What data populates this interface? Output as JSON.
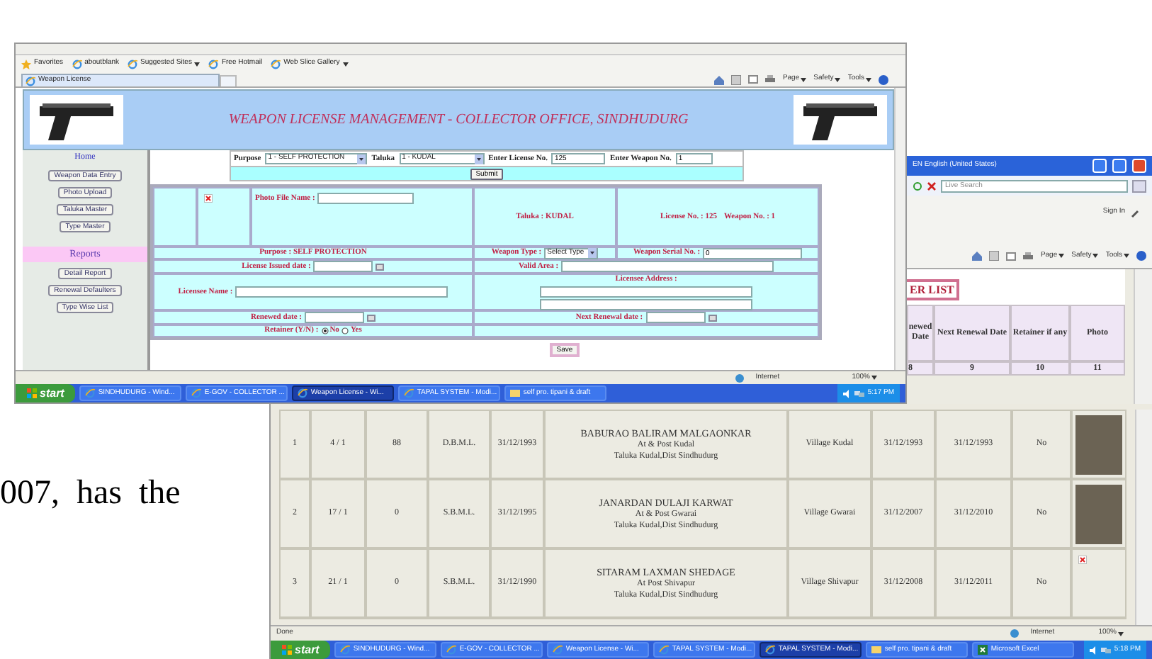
{
  "document_text": "007,  has  the",
  "front_window": {
    "favorites_bar": [
      {
        "label": "Favorites",
        "kind": "favorites"
      },
      {
        "label": "aboutblank",
        "kind": "link"
      },
      {
        "label": "Suggested Sites",
        "kind": "menu"
      },
      {
        "label": "Free Hotmail",
        "kind": "link"
      },
      {
        "label": "Web Slice Gallery",
        "kind": "menu"
      }
    ],
    "tab": "Weapon License",
    "command_bar": [
      "Page",
      "Safety",
      "Tools"
    ],
    "banner_title": "WEAPON LICENSE MANAGEMENT - COLLECTOR OFFICE, SINDHUDURG",
    "sidebar": {
      "home": "Home",
      "buttons": [
        "Weapon Data Entry",
        "Photo Upload",
        "Taluka Master",
        "Type Master"
      ],
      "reports_heading": "Reports",
      "report_buttons": [
        "Detail Report",
        "Renewal Defaulters",
        "Type Wise List"
      ]
    },
    "filter": {
      "purpose_label": "Purpose",
      "purpose_value": "1 - SELF PROTECTION",
      "taluka_label": "Taluka",
      "taluka_value": "1 - KUDAL",
      "license_label": "Enter License No.",
      "license_value": "125",
      "weapon_label": "Enter Weapon No.",
      "weapon_value": "1",
      "submit": "Submit"
    },
    "form": {
      "photo_file_label": "Photo File Name :",
      "taluka": "Taluka : KUDAL",
      "license": "License No. : 125",
      "weapon": "Weapon No. : 1",
      "purpose": "Purpose : SELF PROTECTION",
      "weapon_type_label": "Weapon Type :",
      "weapon_type_value": "Select Type",
      "serial_label": "Weapon Serial No. :",
      "serial_value": "0",
      "issued_label": "License Issued date :",
      "valid_area_label": "Valid Area :",
      "licensee_name_label": "Licensee Name :",
      "address_label": "Licensee Address :",
      "renewed_label": "Renewed date :",
      "next_renewal_label": "Next Renewal date :",
      "retainer_label": "Retainer (Y/N) :",
      "retainer_options": [
        {
          "label": "No",
          "selected": true
        },
        {
          "label": "Yes",
          "selected": false
        }
      ]
    },
    "save": "Save",
    "status_bar": {
      "zone": "Internet",
      "zoom": "100%"
    },
    "taskbar": {
      "start": "start",
      "items": [
        {
          "label": "SINDHUDURG - Wind...",
          "kind": "browser",
          "selected": false
        },
        {
          "label": "E-GOV - COLLECTOR ...",
          "kind": "browser",
          "selected": false
        },
        {
          "label": "Weapon License - Wi...",
          "kind": "browser",
          "selected": true
        },
        {
          "label": "TAPAL SYSTEM - Modi...",
          "kind": "browser",
          "selected": false
        },
        {
          "label": "self pro. tipani & draft",
          "kind": "folder",
          "selected": false
        }
      ],
      "clock": "5:17 PM"
    }
  },
  "back_window": {
    "language_bar": "EN English (United States)",
    "search_placeholder": "Live Search",
    "sign_in": "Sign In",
    "command_bar": [
      "Page",
      "Safety",
      "Tools"
    ],
    "heading": "ER LIST",
    "columns": [
      {
        "header": "newed Date",
        "number": "8"
      },
      {
        "header": "Next Renewal Date",
        "number": "9"
      },
      {
        "header": "Retainer if any",
        "number": "10"
      },
      {
        "header": "Photo",
        "number": "11"
      }
    ],
    "rows": [
      {
        "cells": [
          "1",
          "4 / 1",
          "88",
          "D.B.M.L.",
          "31/12/1993"
        ],
        "licensee": [
          "BABURAO BALIRAM MALGAONKAR",
          "At & Post Kudal",
          "Taluka Kudal,Dist Sindhudurg"
        ],
        "cells_after": [
          "Village Kudal",
          "31/12/1993",
          "31/12/1993",
          "No"
        ],
        "photo": {
          "kind": "photo"
        }
      },
      {
        "cells": [
          "2",
          "17 / 1",
          "0",
          "S.B.M.L.",
          "31/12/1995"
        ],
        "licensee": [
          "JANARDAN DULAJI KARWAT",
          "At & Post Gwarai",
          "Taluka Kudal,Dist Sindhudurg"
        ],
        "cells_after": [
          "Village Gwarai",
          "31/12/2007",
          "31/12/2010",
          "No"
        ],
        "photo": {
          "kind": "photo"
        }
      },
      {
        "cells": [
          "3",
          "21 / 1",
          "0",
          "S.B.M.L.",
          "31/12/1990"
        ],
        "licensee": [
          "SITARAM LAXMAN SHEDAGE",
          "At Post Shivapur",
          "Taluka Kudal,Dist Sindhudurg"
        ],
        "cells_after": [
          "Village Shivapur",
          "31/12/2008",
          "31/12/2011",
          "No"
        ],
        "photo": {
          "kind": "broken"
        }
      }
    ],
    "status_bar": {
      "status": "Done",
      "zone": "Internet",
      "zoom": "100%"
    },
    "taskbar": {
      "start": "start",
      "items": [
        {
          "label": "SINDHUDURG - Wind...",
          "kind": "browser",
          "selected": false
        },
        {
          "label": "E-GOV - COLLECTOR ...",
          "kind": "browser",
          "selected": false
        },
        {
          "label": "Weapon License - Wi...",
          "kind": "browser",
          "selected": false
        },
        {
          "label": "TAPAL SYSTEM - Modi...",
          "kind": "browser",
          "selected": false
        },
        {
          "label": "TAPAL SYSTEM - Modi...",
          "kind": "browser",
          "selected": true
        },
        {
          "label": "self pro. tipani & draft",
          "kind": "folder",
          "selected": false
        },
        {
          "label": "Microsoft Excel",
          "kind": "excel",
          "selected": false
        }
      ],
      "clock": "5:18 PM"
    }
  }
}
